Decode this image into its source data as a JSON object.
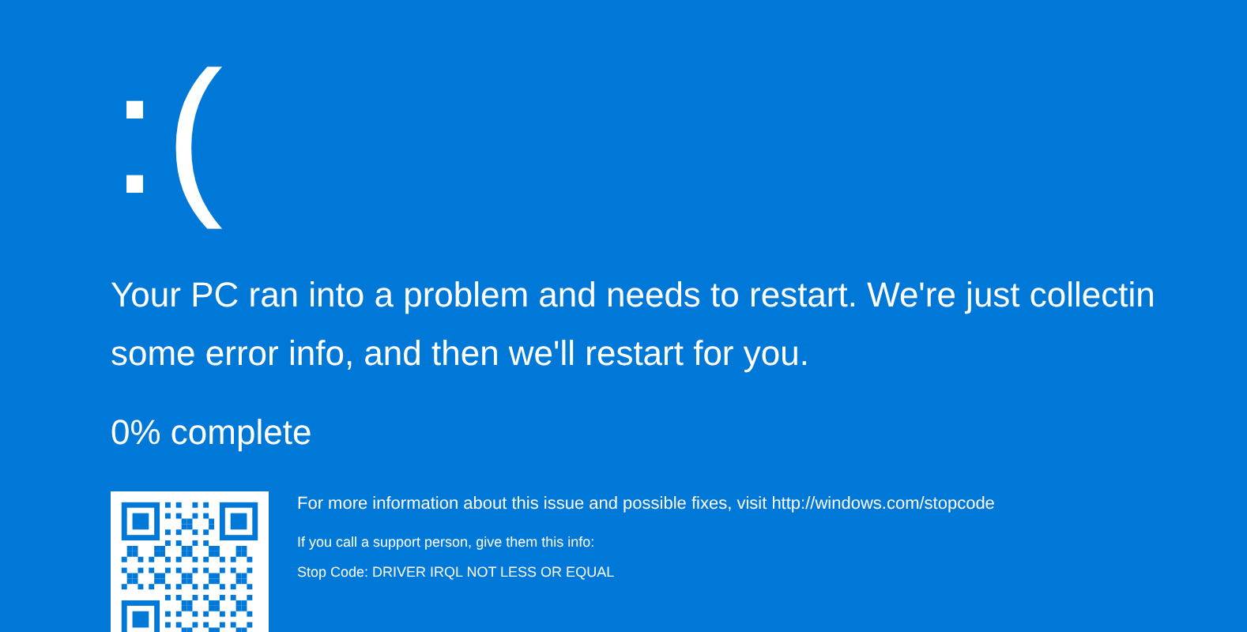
{
  "face": ":(",
  "message_lines": [
    "Your PC ran into a problem and needs to restart. We're just collectin",
    "some error info, and then we'll restart for you."
  ],
  "progress": "0% complete",
  "info": "For more information about this issue and possible fixes, visit http://windows.com/stopcode",
  "support_hint": "If you call a support person, give them this info:",
  "stop_code": "Stop Code: DRIVER IRQL NOT LESS OR EQUAL"
}
